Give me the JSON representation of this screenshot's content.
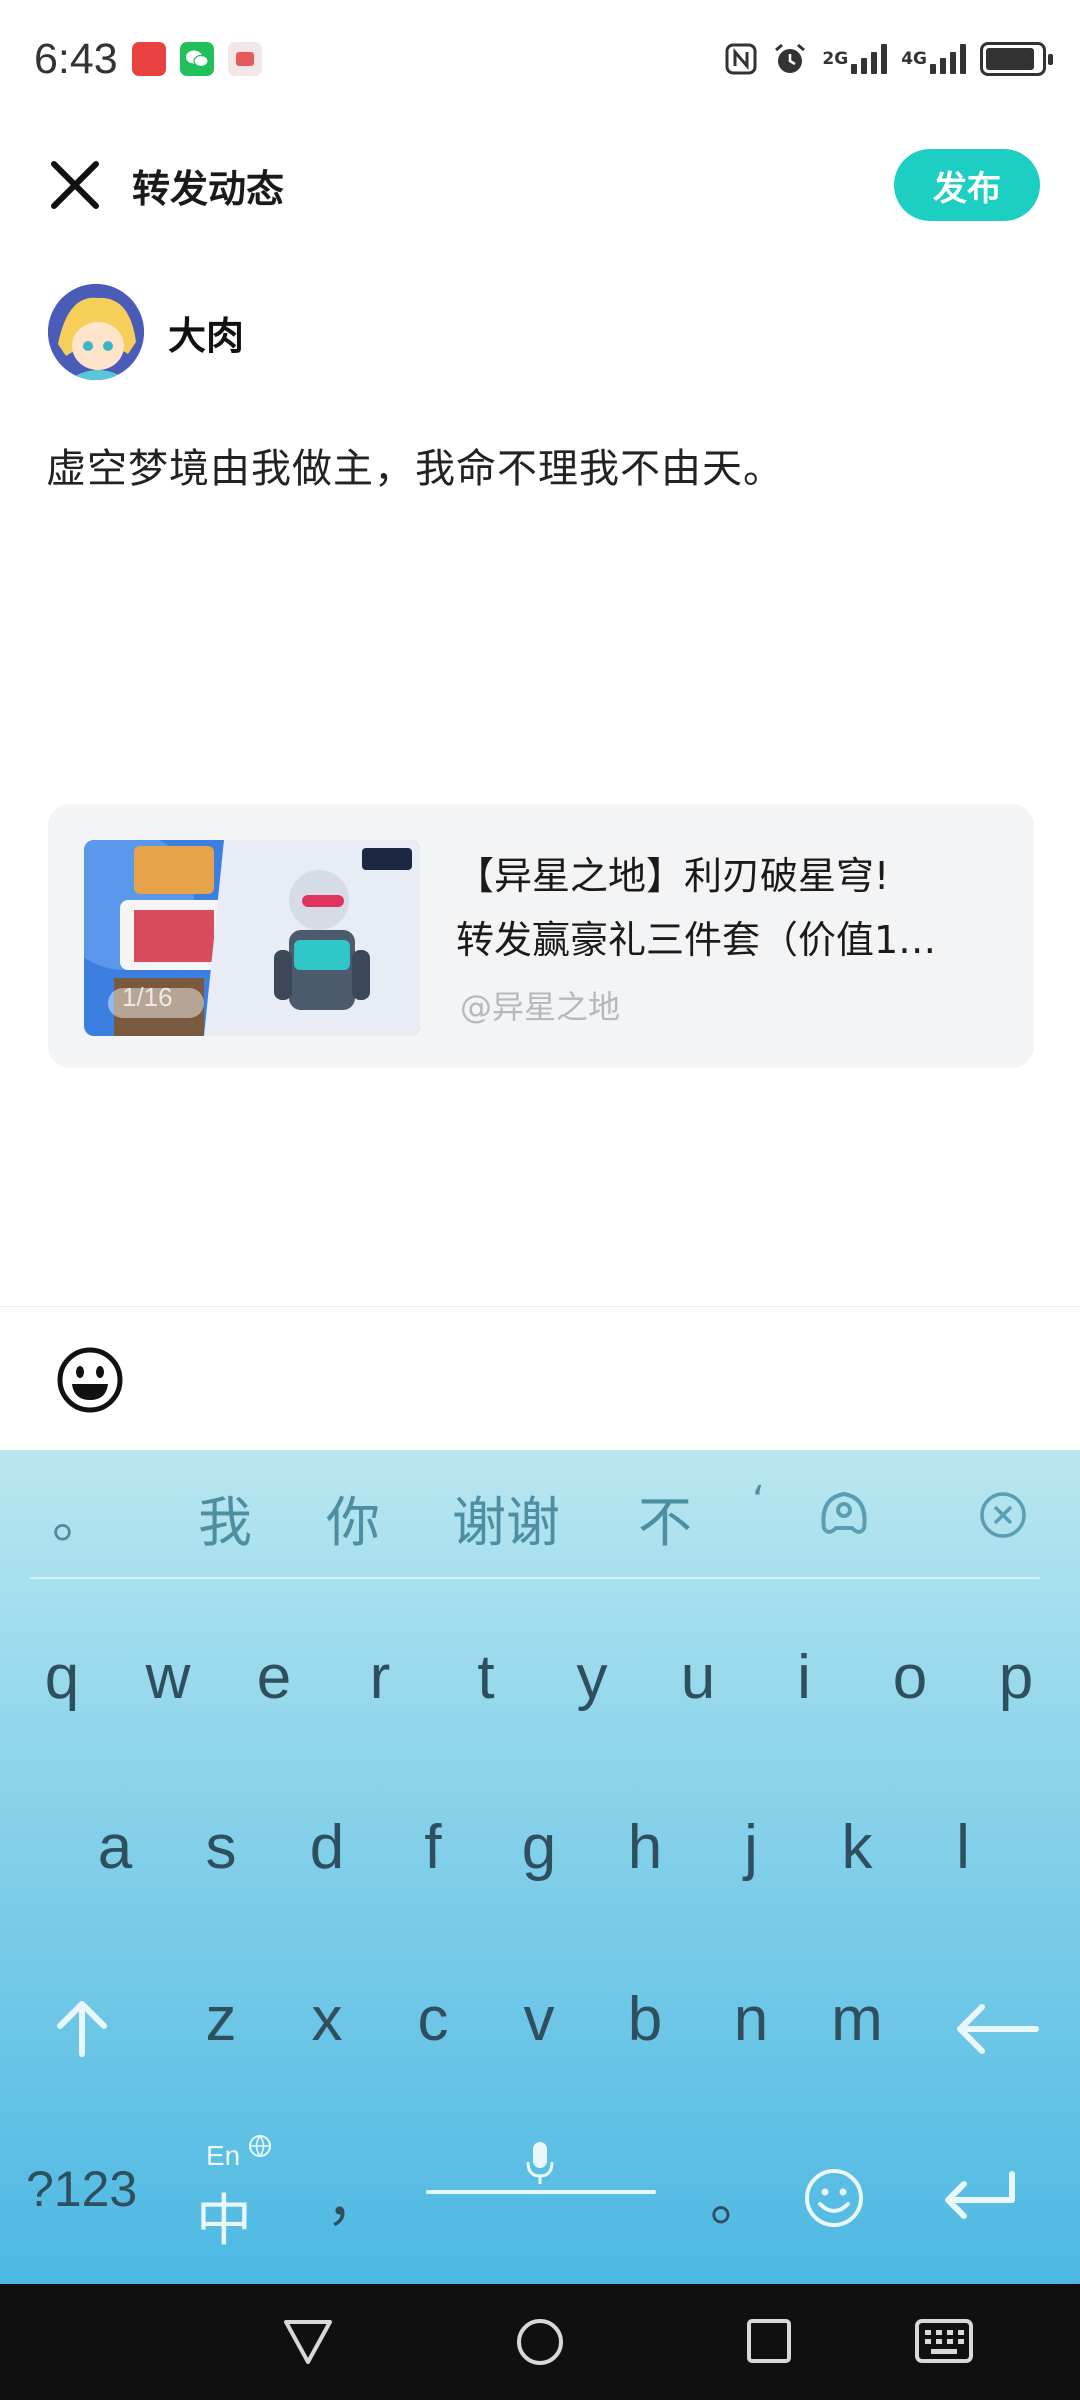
{
  "status_bar": {
    "time": "6:43",
    "network_2g": "2G",
    "network_4g": "4G",
    "icons": [
      "huawei-app-icon",
      "wechat-icon",
      "app-icon",
      "nfc-icon",
      "alarm-icon",
      "signal-icon",
      "battery-icon"
    ]
  },
  "header": {
    "title": "转发动态",
    "publish_label": "发布"
  },
  "user": {
    "name": "大肉"
  },
  "post": {
    "text": "虚空梦境由我做主，我命不理我不由天。"
  },
  "shared_card": {
    "title_line1": "【异星之地】利刃破星穹!",
    "title_line2": "转发赢豪礼三件套（价值1…",
    "author": "@异星之地",
    "thumb_badge": "1/16"
  },
  "keyboard": {
    "candidates": [
      "。",
      "我",
      "你",
      "谢谢",
      "不",
      "‘"
    ],
    "row1": [
      "q",
      "w",
      "e",
      "r",
      "t",
      "y",
      "u",
      "i",
      "o",
      "p"
    ],
    "row2": [
      "a",
      "s",
      "d",
      "f",
      "g",
      "h",
      "j",
      "k",
      "l"
    ],
    "row3": [
      "z",
      "x",
      "c",
      "v",
      "b",
      "n",
      "m"
    ],
    "num_key": "?123",
    "lang_key_top": "En",
    "lang_key_main": "中",
    "comma": "，",
    "period": "。"
  },
  "colors": {
    "accent": "#1ccfc2",
    "keyboard_top": "#b9e7f0",
    "keyboard_bottom": "#4db8e2",
    "navbar": "#101010"
  }
}
